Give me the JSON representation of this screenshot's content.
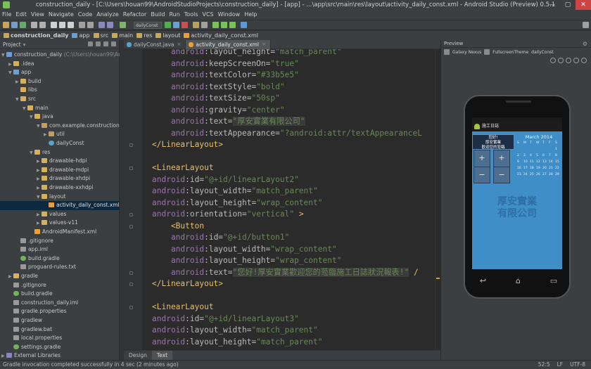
{
  "window": {
    "title": "construction_daily - [C:\\Users\\houan99\\AndroidStudioProjects\\construction_daily] - [app] - ...\\app\\src\\main\\res\\layout\\activity_daily_const.xml - Android Studio (Preview) 0.5.1",
    "min": "—",
    "max": "▢",
    "close": "✕"
  },
  "menu": [
    "File",
    "Edit",
    "View",
    "Navigate",
    "Code",
    "Analyze",
    "Refactor",
    "Build",
    "Run",
    "Tools",
    "VCS",
    "Window",
    "Help"
  ],
  "toolbar": {
    "run_config": "dailyConst"
  },
  "breadcrumbs": [
    "construction_daily",
    "app",
    "src",
    "main",
    "res",
    "layout",
    "activity_daily_const.xml"
  ],
  "project_panel": {
    "header": "Project",
    "header_icons": [
      "⊕",
      "⇵",
      "⚙",
      "⇥"
    ]
  },
  "tree": [
    {
      "indent": 0,
      "arrow": "▼",
      "icon": "module",
      "label": "construction_daily",
      "sub": " (C:\\Users\\houan99\\Andr"
    },
    {
      "indent": 1,
      "arrow": "▶",
      "icon": "folder",
      "label": ".idea"
    },
    {
      "indent": 1,
      "arrow": "▼",
      "icon": "module",
      "label": "app"
    },
    {
      "indent": 2,
      "arrow": "▶",
      "icon": "folder",
      "label": "build"
    },
    {
      "indent": 2,
      "arrow": "",
      "icon": "folder",
      "label": "libs"
    },
    {
      "indent": 2,
      "arrow": "▼",
      "icon": "folder",
      "label": "src"
    },
    {
      "indent": 3,
      "arrow": "▼",
      "icon": "folder",
      "label": "main"
    },
    {
      "indent": 4,
      "arrow": "▼",
      "icon": "folder",
      "label": "java"
    },
    {
      "indent": 5,
      "arrow": "▼",
      "icon": "pkg",
      "label": "com.example.construction_d"
    },
    {
      "indent": 6,
      "arrow": "▶",
      "icon": "pkg",
      "label": "util"
    },
    {
      "indent": 6,
      "arrow": "",
      "icon": "java",
      "label": "dailyConst"
    },
    {
      "indent": 4,
      "arrow": "▼",
      "icon": "folder",
      "label": "res"
    },
    {
      "indent": 5,
      "arrow": "▶",
      "icon": "folder",
      "label": "drawable-hdpi"
    },
    {
      "indent": 5,
      "arrow": "▶",
      "icon": "folder",
      "label": "drawable-mdpi"
    },
    {
      "indent": 5,
      "arrow": "▶",
      "icon": "folder",
      "label": "drawable-xhdpi"
    },
    {
      "indent": 5,
      "arrow": "▶",
      "icon": "folder",
      "label": "drawable-xxhdpi"
    },
    {
      "indent": 5,
      "arrow": "▼",
      "icon": "folder",
      "label": "layout"
    },
    {
      "indent": 6,
      "arrow": "",
      "icon": "xml",
      "label": "activity_daily_const.xml",
      "selected": true
    },
    {
      "indent": 5,
      "arrow": "▶",
      "icon": "folder",
      "label": "values"
    },
    {
      "indent": 5,
      "arrow": "▶",
      "icon": "folder",
      "label": "values-v11"
    },
    {
      "indent": 4,
      "arrow": "",
      "icon": "xml",
      "label": "AndroidManifest.xml"
    },
    {
      "indent": 2,
      "arrow": "",
      "icon": "file",
      "label": ".gitignore"
    },
    {
      "indent": 2,
      "arrow": "",
      "icon": "file",
      "label": "app.iml"
    },
    {
      "indent": 2,
      "arrow": "",
      "icon": "gradle",
      "label": "build.gradle"
    },
    {
      "indent": 2,
      "arrow": "",
      "icon": "file",
      "label": "proguard-rules.txt"
    },
    {
      "indent": 1,
      "arrow": "▶",
      "icon": "folder",
      "label": "gradle"
    },
    {
      "indent": 1,
      "arrow": "",
      "icon": "file",
      "label": ".gitignore"
    },
    {
      "indent": 1,
      "arrow": "",
      "icon": "gradle",
      "label": "build.gradle"
    },
    {
      "indent": 1,
      "arrow": "",
      "icon": "file",
      "label": "construction_daily.iml"
    },
    {
      "indent": 1,
      "arrow": "",
      "icon": "file",
      "label": "gradle.properties"
    },
    {
      "indent": 1,
      "arrow": "",
      "icon": "file",
      "label": "gradlew"
    },
    {
      "indent": 1,
      "arrow": "",
      "icon": "file",
      "label": "gradlew.bat"
    },
    {
      "indent": 1,
      "arrow": "",
      "icon": "file",
      "label": "local.properties"
    },
    {
      "indent": 1,
      "arrow": "",
      "icon": "gradle",
      "label": "settings.gradle"
    },
    {
      "indent": 0,
      "arrow": "▶",
      "icon": "lib",
      "label": "External Libraries"
    }
  ],
  "editor_tabs": [
    {
      "label": "dailyConst.java",
      "active": false
    },
    {
      "label": "activity_daily_const.xml",
      "active": true
    }
  ],
  "code_lines": [
    [
      [
        "ns",
        "    android"
      ],
      [
        "attr",
        ":layout_height="
      ],
      [
        "val",
        "\"match_parent\""
      ]
    ],
    [
      [
        "ns",
        "    android"
      ],
      [
        "attr",
        ":keepScreenOn="
      ],
      [
        "val",
        "\"true\""
      ]
    ],
    [
      [
        "ns",
        "    android"
      ],
      [
        "attr",
        ":textColor="
      ],
      [
        "val",
        "\"#33b5e5\""
      ]
    ],
    [
      [
        "ns",
        "    android"
      ],
      [
        "attr",
        ":textStyle="
      ],
      [
        "val",
        "\"bold\""
      ]
    ],
    [
      [
        "ns",
        "    android"
      ],
      [
        "attr",
        ":textSize="
      ],
      [
        "val",
        "\"50sp\""
      ]
    ],
    [
      [
        "ns",
        "    android"
      ],
      [
        "attr",
        ":gravity="
      ],
      [
        "val",
        "\"center\""
      ]
    ],
    [
      [
        "ns",
        "    android"
      ],
      [
        "attr",
        ":text="
      ],
      [
        "val",
        "\"厚安實業有限公司\""
      ]
    ],
    [
      [
        "ns",
        "    android"
      ],
      [
        "attr",
        ":textAppearance="
      ],
      [
        "val",
        "\"?android:attr/textAppearanceL"
      ]
    ],
    [
      [
        "tag",
        "</LinearLayout>"
      ]
    ],
    [
      [
        "plain",
        ""
      ]
    ],
    [
      [
        "tag",
        "<LinearLayout"
      ]
    ],
    [
      [
        "ns",
        "android"
      ],
      [
        "attr",
        ":id="
      ],
      [
        "val",
        "\"@+id/linearLayout2\""
      ]
    ],
    [
      [
        "ns",
        "android"
      ],
      [
        "attr",
        ":layout_width="
      ],
      [
        "val",
        "\"match_parent\""
      ]
    ],
    [
      [
        "ns",
        "android"
      ],
      [
        "attr",
        ":layout_height="
      ],
      [
        "val",
        "\"wrap_content\""
      ]
    ],
    [
      [
        "ns",
        "android"
      ],
      [
        "attr",
        ":orientation="
      ],
      [
        "val",
        "\"vertical\""
      ],
      [
        "tag",
        " >"
      ]
    ],
    [
      [
        "tag",
        "    <Button"
      ]
    ],
    [
      [
        "ns",
        "    android"
      ],
      [
        "attr",
        ":id="
      ],
      [
        "val",
        "\"@+id/button1\""
      ]
    ],
    [
      [
        "ns",
        "    android"
      ],
      [
        "attr",
        ":layout_width="
      ],
      [
        "val",
        "\"wrap_content\""
      ]
    ],
    [
      [
        "ns",
        "    android"
      ],
      [
        "attr",
        ":layout_height="
      ],
      [
        "val",
        "\"wrap_content\""
      ]
    ],
    [
      [
        "ns",
        "    android"
      ],
      [
        "attr",
        ":text="
      ],
      [
        "val",
        "\"您好!厚安實業歡迎您的蒞臨施工日誌狀況報表!\""
      ],
      [
        "tag",
        " /"
      ]
    ],
    [
      [
        "tag",
        "</LinearLayout>"
      ]
    ],
    [
      [
        "plain",
        ""
      ]
    ],
    [
      [
        "tag",
        "<LinearLayout"
      ]
    ],
    [
      [
        "ns",
        "android"
      ],
      [
        "attr",
        ":id="
      ],
      [
        "val",
        "\"@+id/linearLayout3\""
      ]
    ],
    [
      [
        "ns",
        "android"
      ],
      [
        "attr",
        ":layout_width="
      ],
      [
        "val",
        "\"match_parent\""
      ]
    ],
    [
      [
        "ns",
        "android"
      ],
      [
        "attr",
        ":layout_height="
      ],
      [
        "val",
        "\"match_parent\""
      ]
    ]
  ],
  "editor_bottom_tabs": [
    {
      "label": "Design",
      "active": false
    },
    {
      "label": "Text",
      "active": true
    }
  ],
  "preview": {
    "header": "Preview",
    "device": "Galaxy Nexus",
    "theme": "FullscreenTheme",
    "activity": "dailyConst",
    "app_title": "施工日誌",
    "button_text_line1": "您好!",
    "button_text_line2": "厚安實業",
    "button_text_line3": "歡迎您的蒞臨",
    "calendar_month": "March 2014",
    "calendar_weekdays": [
      "S",
      "M",
      "T",
      "W",
      "T",
      "F",
      "S"
    ],
    "calendar_days": [
      "",
      "",
      "",
      "",
      "",
      "",
      "1",
      "2",
      "3",
      "4",
      "5",
      "6",
      "7",
      "8",
      "9",
      "10",
      "11",
      "12",
      "13",
      "14",
      "15",
      "16",
      "17",
      "18",
      "19",
      "20",
      "21",
      "22",
      "23",
      "24",
      "25",
      "26",
      "27",
      "28",
      "29"
    ],
    "stepper_plus": "+",
    "stepper_minus": "−",
    "company_line1": "厚安實業",
    "company_line2": "有限公司"
  },
  "status": {
    "message": "Gradle invocation completed successfully in 4 sec (2 minutes ago)",
    "position": "52:5",
    "line_sep": "LF",
    "encoding": "UTF-8"
  }
}
